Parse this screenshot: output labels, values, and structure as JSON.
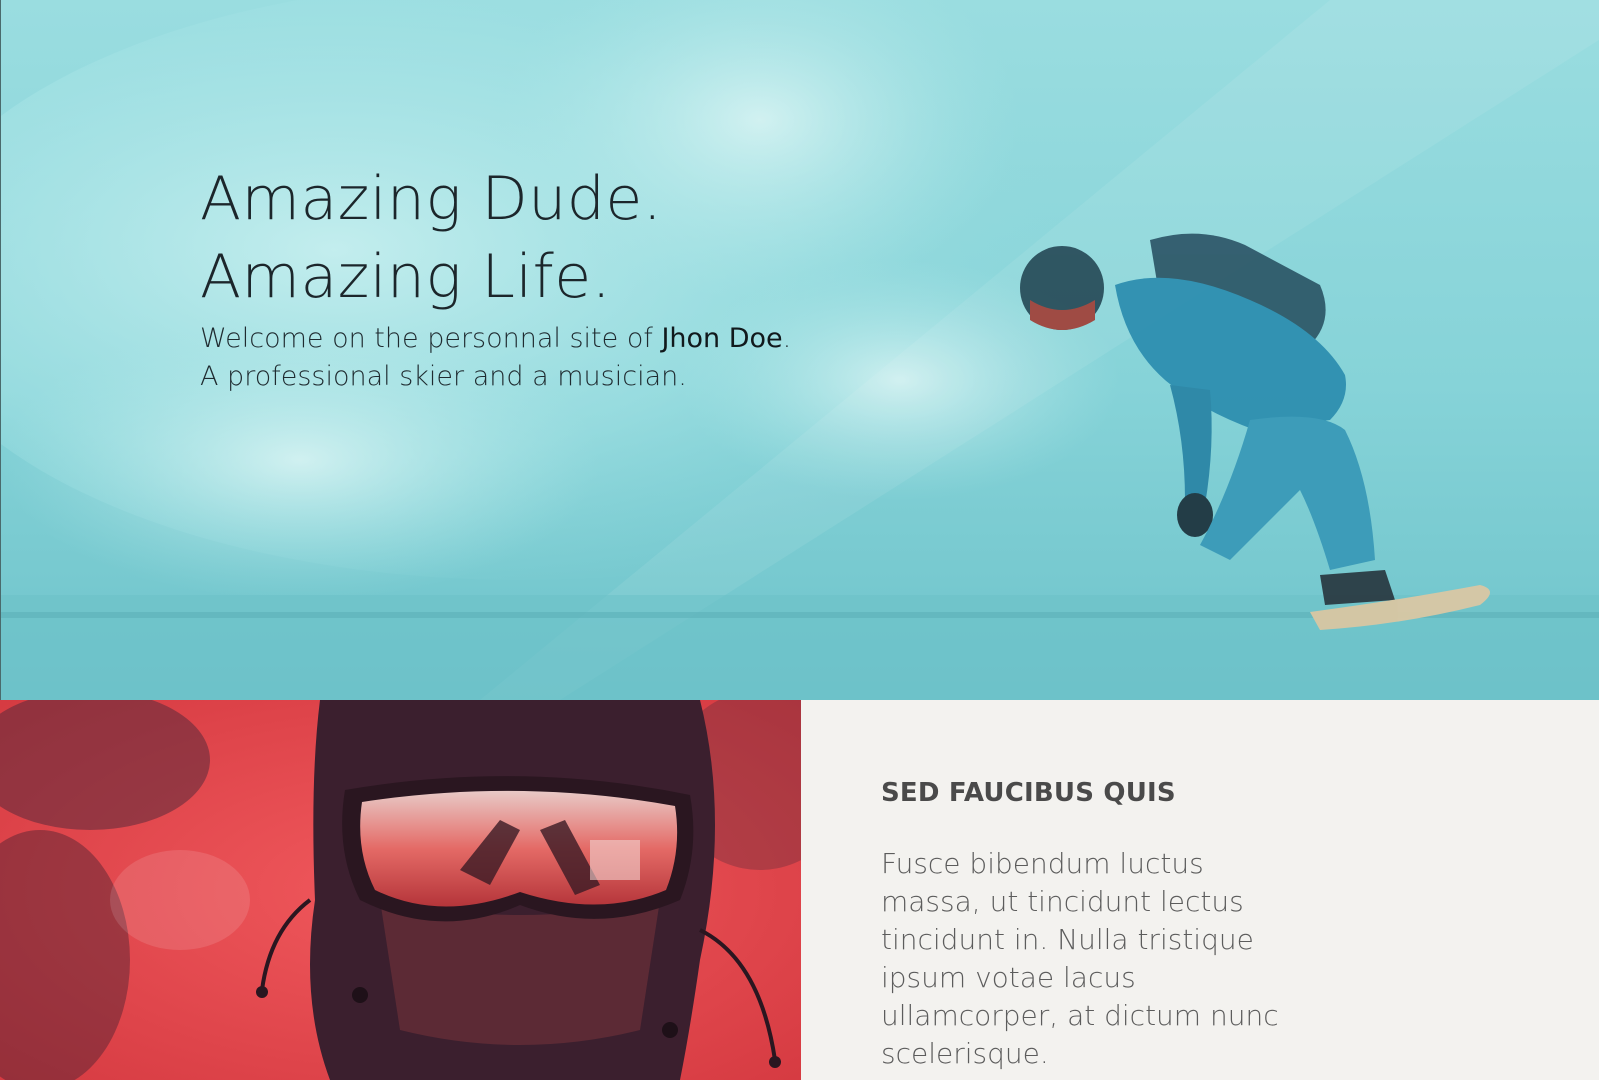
{
  "hero": {
    "title_line1": "Amazing Dude.",
    "title_line2": "Amazing Life.",
    "welcome_prefix": "Welcome on the personnal site of ",
    "owner_name": "Jhon Doe",
    "welcome_suffix": ".",
    "tagline": "A professional skier and a musician.",
    "image_subject": "snowboarder-photo",
    "tint_color": "#7fd0d6"
  },
  "feature": {
    "image_subject": "skier-goggles-portrait",
    "tint_color": "#e8474c",
    "heading": "SED FAUCIBUS QUIS",
    "body": "Fusce bibendum luctus massa, ut tincidunt lectus tincidunt in. Nulla tristique ipsum votae lacus ullamcorper, at dictum nunc scelerisque.",
    "panel_color": "#f3f2ef"
  }
}
